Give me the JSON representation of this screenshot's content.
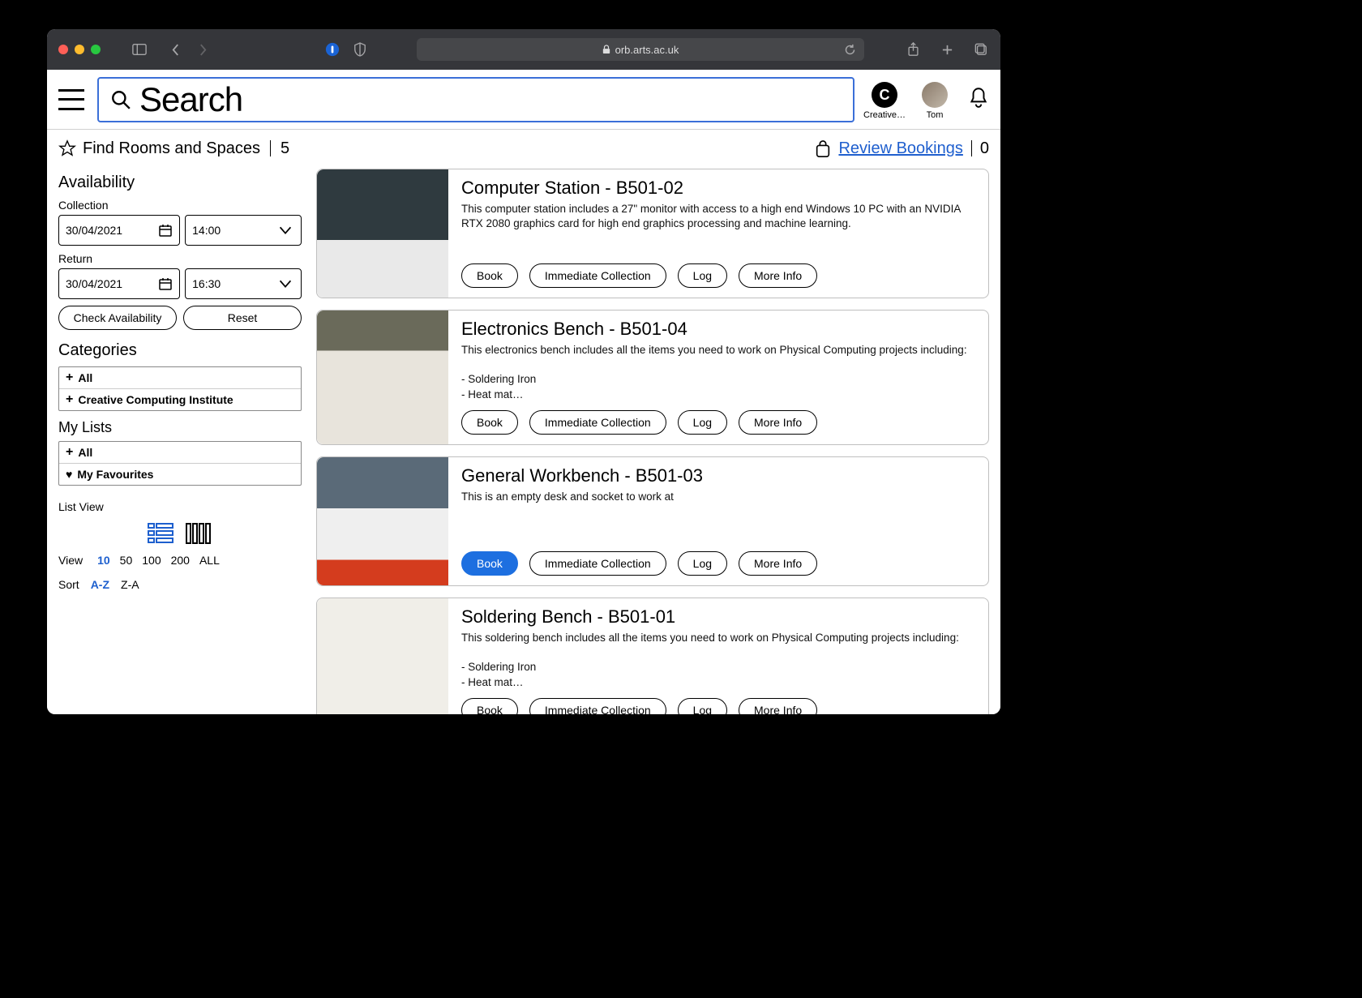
{
  "browser": {
    "url_display": "orb.arts.ac.uk"
  },
  "header": {
    "search_placeholder": "Search",
    "org_label": "Creative …",
    "user_name": "Tom",
    "org_initial": "C"
  },
  "subheader": {
    "title": "Find Rooms and Spaces",
    "count": "5",
    "review_label": "Review Bookings",
    "review_count": "0"
  },
  "availability": {
    "heading": "Availability",
    "collection_label": "Collection",
    "collection_date": "30/04/2021",
    "collection_time": "14:00",
    "return_label": "Return",
    "return_date": "30/04/2021",
    "return_time": "16:30",
    "check_btn": "Check Availability",
    "reset_btn": "Reset"
  },
  "categories": {
    "heading": "Categories",
    "items": [
      "All",
      "Creative Computing Institute"
    ]
  },
  "mylists": {
    "heading": "My Lists",
    "item_all": "All",
    "item_fav": "My Favourites"
  },
  "listview": {
    "heading": "List View",
    "view_label": "View",
    "view_options": [
      "10",
      "50",
      "100",
      "200",
      "ALL"
    ],
    "view_selected": "10",
    "sort_label": "Sort",
    "sort_options": [
      "A-Z",
      "Z-A"
    ],
    "sort_selected": "A-Z"
  },
  "actions": {
    "book": "Book",
    "immediate": "Immediate Collection",
    "log": "Log",
    "more": "More Info"
  },
  "results": [
    {
      "title": "Computer Station - B501-02",
      "desc": "This computer station includes a 27\" monitor with access to a high end Windows 10 PC with an NVIDIA RTX 2080 graphics card for high end graphics processing and machine learning.",
      "img": "img-computer",
      "book_primary": false
    },
    {
      "title": "Electronics Bench - B501-04",
      "desc": "This electronics bench includes all the items you need to work on Physical Computing projects including:\n\n- Soldering Iron\n- Heat mat…",
      "img": "img-elec",
      "book_primary": false
    },
    {
      "title": "General Workbench - B501-03",
      "desc": "This is an empty desk and socket to work at",
      "img": "img-wb",
      "book_primary": true
    },
    {
      "title": "Soldering Bench - B501-01",
      "desc": "This soldering bench includes all the items you need to work on Physical Computing projects including:\n\n- Soldering Iron\n- Heat mat…",
      "img": "img-sold",
      "book_primary": false
    }
  ]
}
